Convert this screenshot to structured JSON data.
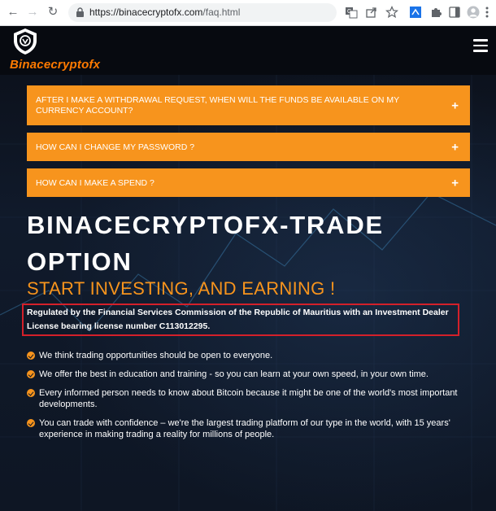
{
  "browser": {
    "url_host": "https://binacecryptofx.com",
    "url_path": "/faq.html",
    "icons": [
      "back-icon",
      "forward-icon",
      "reload-icon",
      "lock-icon",
      "translate-icon",
      "share-icon",
      "star-icon",
      "extension-icon",
      "puzzle-icon",
      "sidebar-icon",
      "profile-icon",
      "menu-dots-icon"
    ]
  },
  "site": {
    "logo_text": "Binacecryptofx",
    "faq": [
      {
        "question": "AFTER I MAKE A WITHDRAWAL REQUEST, WHEN WILL THE FUNDS BE AVAILABLE ON MY CURRENCY ACCOUNT?",
        "toggle": "+"
      },
      {
        "question": "HOW CAN I CHANGE MY PASSWORD ?",
        "toggle": "+"
      },
      {
        "question": "HOW CAN I MAKE A SPEND ?",
        "toggle": "+"
      }
    ],
    "headline_line1": "BINACECRYPTOFX-TRADE",
    "headline_line2": "OPTION",
    "subhead": "START INVESTING, AND EARNING !",
    "regulation": "Regulated by the Financial Services Commission of the Republic of Mauritius with an Investment Dealer License bearing license number C113012295.",
    "bullets": [
      "We think trading opportunities should be open to everyone.",
      "We offer the best in education and training - so you can learn at your own speed, in your own time.",
      "Every informed person needs to know about Bitcoin because it might be one of the world's most important developments.",
      "You can trade with confidence – we're the largest trading platform of our type in the world, with 15 years' experience in making trading a reality for millions of people."
    ],
    "colors": {
      "accent": "#f7941d",
      "logo": "#ff7a00",
      "highlight_border": "#d4202a",
      "background": "#0d1421"
    }
  }
}
